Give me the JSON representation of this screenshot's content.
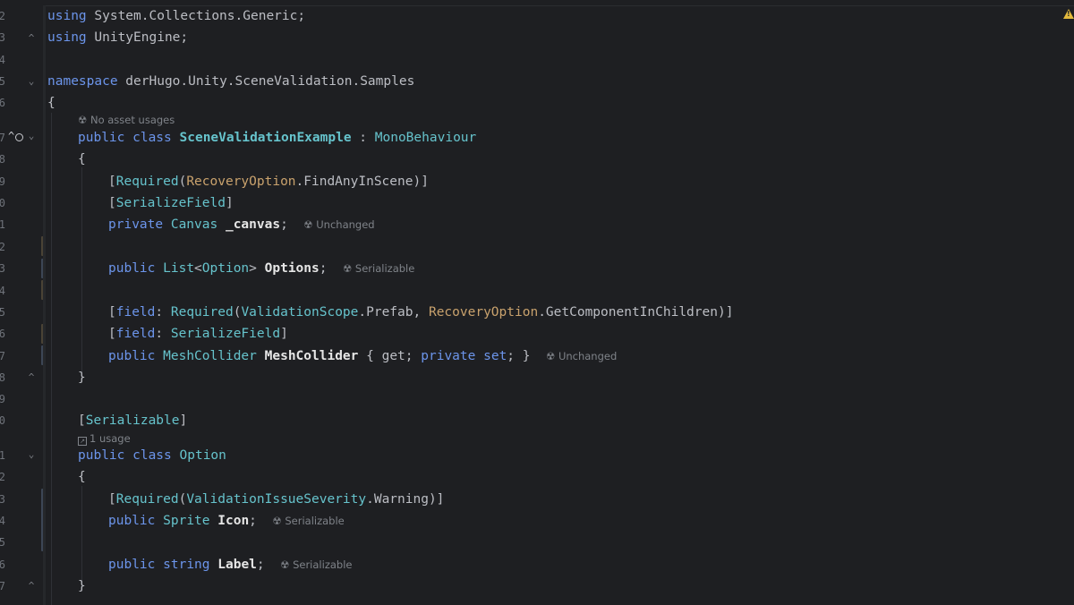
{
  "gutter": {
    "line_numbers": [
      "2",
      "3",
      "4",
      "5",
      "6",
      "7",
      "8",
      "9",
      "0",
      "1",
      "2",
      "3",
      "4",
      "5",
      "6",
      "7",
      "8",
      "9",
      "0",
      "1",
      "2",
      "3",
      "4",
      "5",
      "6",
      "7"
    ]
  },
  "code": {
    "l1": {
      "kw": "using",
      "rest": " System.Collections.Generic;"
    },
    "l2": {
      "kw": "using",
      "rest": " UnityEngine;"
    },
    "l4": {
      "kw": "namespace",
      "rest": " derHugo.Unity.SceneValidation.Samples"
    },
    "l5": {
      "brace": "{"
    },
    "hint_no_usages": "No asset usages",
    "l6": {
      "kw": "public class",
      "name": "SceneValidationExample",
      "sep": " : ",
      "base": "MonoBehaviour"
    },
    "l7": {
      "brace": "{"
    },
    "l8": {
      "open": "[",
      "attr": "Required",
      "p1": "(",
      "ty": "RecoveryOption",
      "rest": ".FindAnyInScene)]"
    },
    "l9": {
      "open": "[",
      "attr": "SerializeField",
      "close": "]"
    },
    "l10": {
      "kw": "private",
      "ty": "Canvas",
      "name": "_canvas",
      "semi": ";",
      "hint": "Unchanged"
    },
    "l12": {
      "kw": "public",
      "ty": "List",
      "lt": "<",
      "ty2": "Option",
      "gt": ">",
      "name": "Options",
      "semi": ";",
      "hint": "Serializable"
    },
    "l14": {
      "open": "[",
      "target": "field",
      "colon": ": ",
      "attr": "Required",
      "p1": "(",
      "ty": "ValidationScope",
      "mid": ".Prefab, ",
      "ty2": "RecoveryOption",
      "rest": ".GetComponentInChildren)]"
    },
    "l15": {
      "open": "[",
      "target": "field",
      "colon": ": ",
      "attr": "SerializeField",
      "close": "]"
    },
    "l16": {
      "kw": "public",
      "ty": "MeshCollider",
      "name": "MeshCollider",
      "b1": " { ",
      "get": "get",
      "semi1": "; ",
      "kw2": "private set",
      "semi2": "; }",
      "hint": "Unchanged"
    },
    "l17": {
      "brace": "}"
    },
    "l19": {
      "open": "[",
      "attr": "Serializable",
      "close": "]"
    },
    "hint_usage": "1 usage",
    "l20": {
      "kw": "public class",
      "name": "Option"
    },
    "l21": {
      "brace": "{"
    },
    "l22": {
      "open": "[",
      "attr": "Required",
      "p1": "(",
      "ty": "ValidationIssueSeverity",
      "rest": ".Warning)]"
    },
    "l23": {
      "kw": "public",
      "ty": "Sprite",
      "name": "Icon",
      "semi": ";",
      "hint": "Serializable"
    },
    "l25": {
      "kw": "public",
      "ty": "string",
      "name": "Label",
      "semi": ";",
      "hint": "Serializable"
    },
    "l26": {
      "brace": "}"
    }
  }
}
